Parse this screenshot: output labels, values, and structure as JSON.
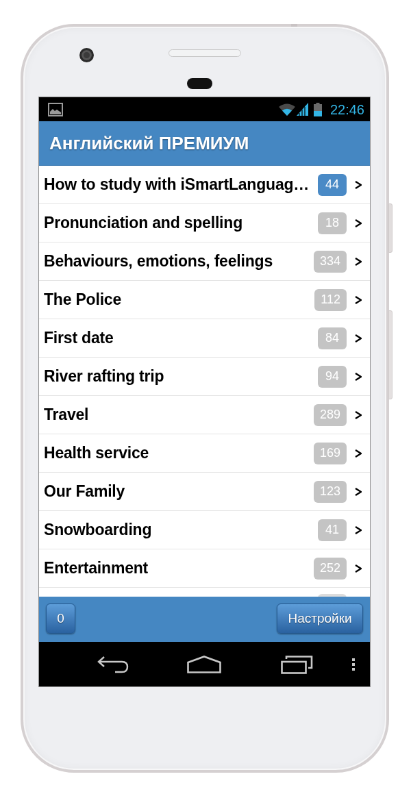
{
  "status_bar": {
    "time": "22:46"
  },
  "header": {
    "title": "Английский ПРЕМИУМ"
  },
  "topics": [
    {
      "title": "How to study with iSmartLanguag…",
      "count": "44",
      "selected": true
    },
    {
      "title": "Pronunciation and spelling",
      "count": "18",
      "selected": false
    },
    {
      "title": "Behaviours, emotions, feelings",
      "count": "334",
      "selected": false
    },
    {
      "title": "The Police",
      "count": "112",
      "selected": false
    },
    {
      "title": "First date",
      "count": "84",
      "selected": false
    },
    {
      "title": "River rafting trip",
      "count": "94",
      "selected": false
    },
    {
      "title": "Travel",
      "count": "289",
      "selected": false
    },
    {
      "title": "Health service",
      "count": "169",
      "selected": false
    },
    {
      "title": "Our Family",
      "count": "123",
      "selected": false
    },
    {
      "title": "Snowboarding",
      "count": "41",
      "selected": false
    },
    {
      "title": "Entertainment",
      "count": "252",
      "selected": false
    }
  ],
  "toolbar": {
    "buttons": [
      {
        "label": "0",
        "kind": "small"
      },
      {
        "label": "Настройки",
        "kind": "wide"
      }
    ]
  }
}
